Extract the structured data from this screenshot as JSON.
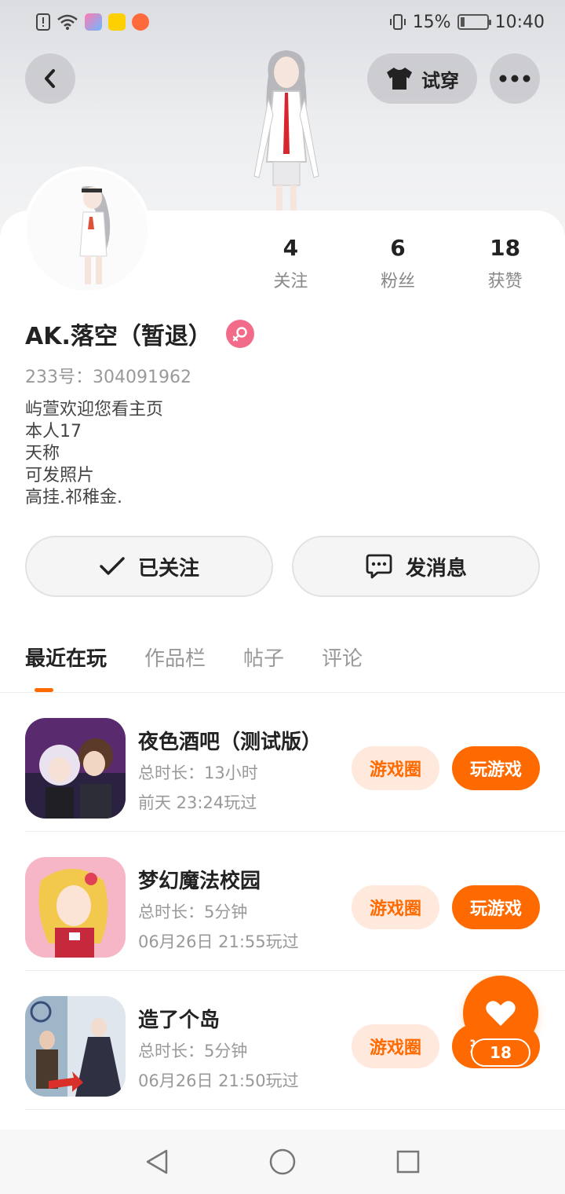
{
  "status_bar": {
    "battery": "15%",
    "time": "10:40"
  },
  "header": {
    "back_icon": "chevron-left-icon",
    "tryon_label": "试穿",
    "more_icon": "more-dots-icon"
  },
  "profile": {
    "name": "AK.落空（暂退）",
    "gender_icon": "female-icon",
    "uid": "233号：304091962",
    "bio": [
      "屿萱欢迎您看主页",
      "本人17",
      "天称",
      "可发照片",
      "高挂.祁稚金."
    ],
    "stats": [
      {
        "value": "4",
        "label": "关注"
      },
      {
        "value": "6",
        "label": "粉丝"
      },
      {
        "value": "18",
        "label": "获赞"
      }
    ]
  },
  "actions": {
    "follow_label": "已关注",
    "message_label": "发消息"
  },
  "tabs": [
    "最近在玩",
    "作品栏",
    "帖子",
    "评论"
  ],
  "games": [
    {
      "title": "夜色酒吧（测试版）",
      "duration": "总时长：13小时",
      "last_played": "前天 23:24玩过",
      "circle_label": "游戏圈",
      "play_label": "玩游戏"
    },
    {
      "title": "梦幻魔法校园",
      "duration": "总时长：5分钟",
      "last_played": "06月26日 21:55玩过",
      "circle_label": "游戏圈",
      "play_label": "玩游戏"
    },
    {
      "title": "造了个岛",
      "duration": "总时长：5分钟",
      "last_played": "06月26日 21:50玩过",
      "circle_label": "游戏圈",
      "play_label": "玩游戏"
    }
  ],
  "like_fab": {
    "count": "18",
    "icon": "heart-icon"
  },
  "colors": {
    "accent": "#ff6a00",
    "accent_light": "#ffe8dc",
    "gender_badge": "#f26c8a"
  }
}
